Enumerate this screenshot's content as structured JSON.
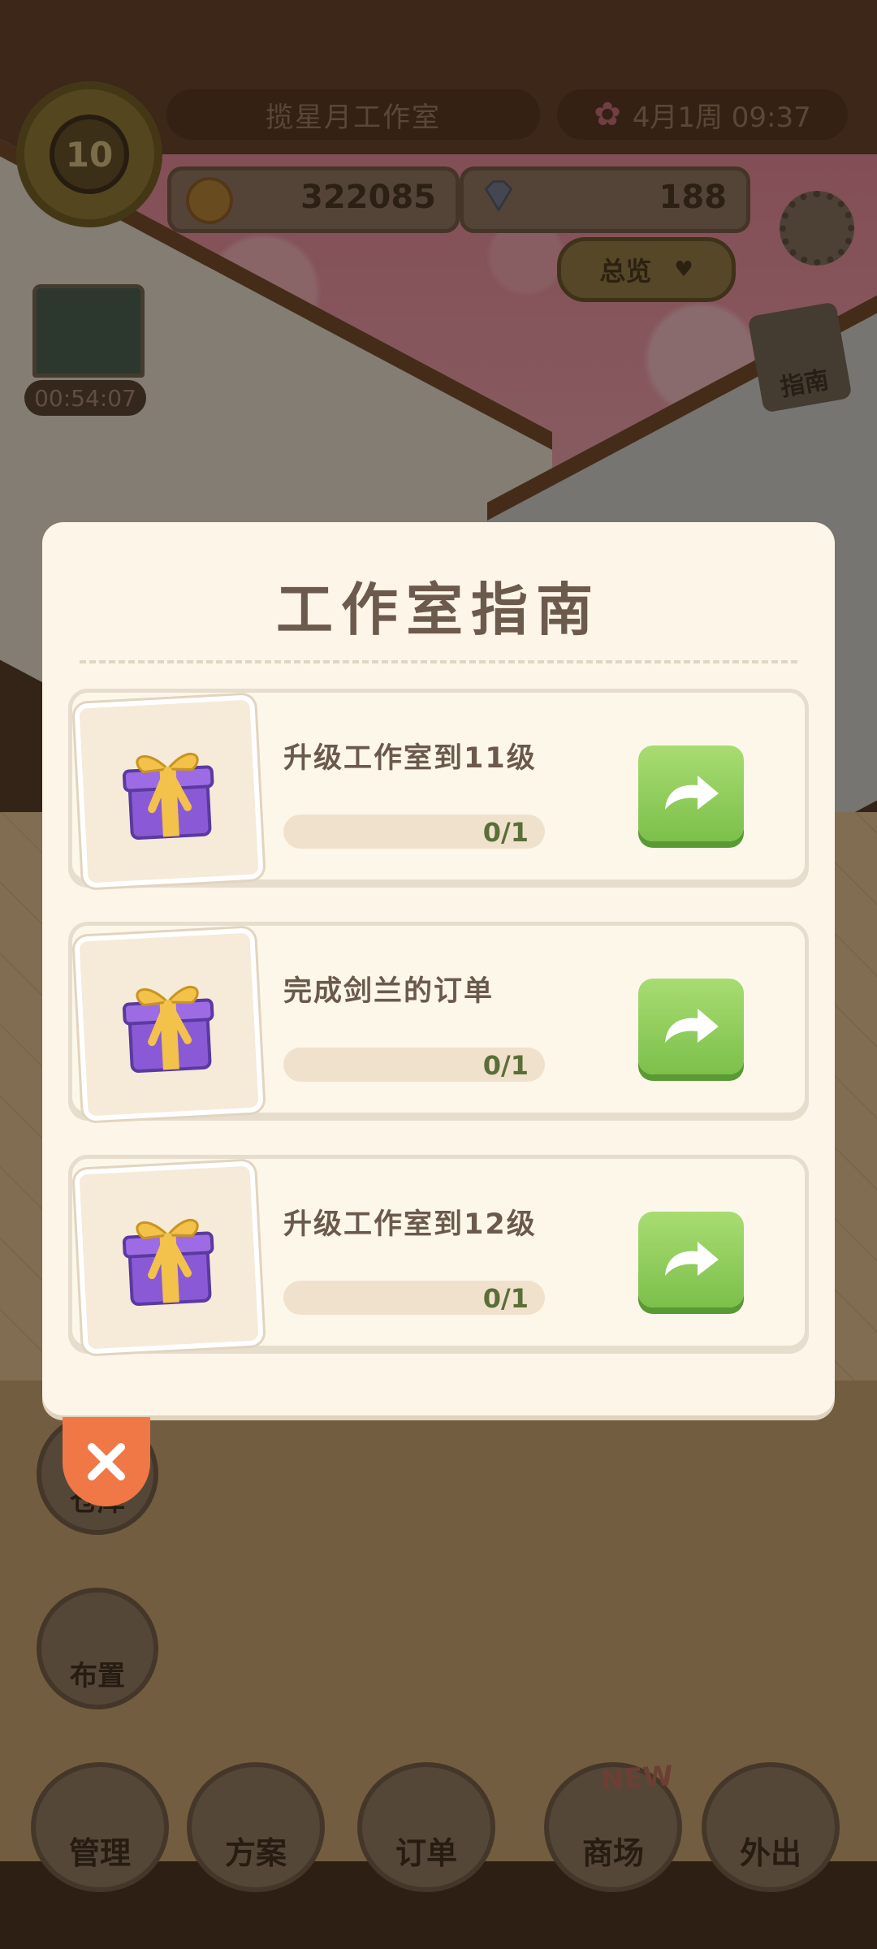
{
  "hud": {
    "level": "10",
    "studio_name": "揽星月工作室",
    "date_time": "4月1周  09:37",
    "coins": "322085",
    "gems": "188",
    "overview_label": "总览",
    "timer": "00:54:07",
    "guide_label": "指南"
  },
  "side_buttons": [
    {
      "label": "仓库"
    },
    {
      "label": "布置"
    }
  ],
  "bottom_nav": [
    {
      "label": "管理"
    },
    {
      "label": "方案"
    },
    {
      "label": "订单"
    },
    {
      "label": "商场",
      "badge": "NEW"
    },
    {
      "label": "外出"
    }
  ],
  "modal": {
    "title": "工作室指南",
    "tasks": [
      {
        "label": "升级工作室到11级",
        "progress_text": "0/1",
        "progress": 0
      },
      {
        "label": "完成剑兰的订单",
        "progress_text": "0/1",
        "progress": 0
      },
      {
        "label": "升级工作室到12级",
        "progress_text": "0/1",
        "progress": 0
      }
    ]
  },
  "colors": {
    "accent_green": "#7cc04a",
    "close_orange": "#f07846",
    "modal_bg": "#fcf5e8",
    "gift_purple": "#8a5ad6",
    "gift_ribbon": "#f2c24a"
  }
}
